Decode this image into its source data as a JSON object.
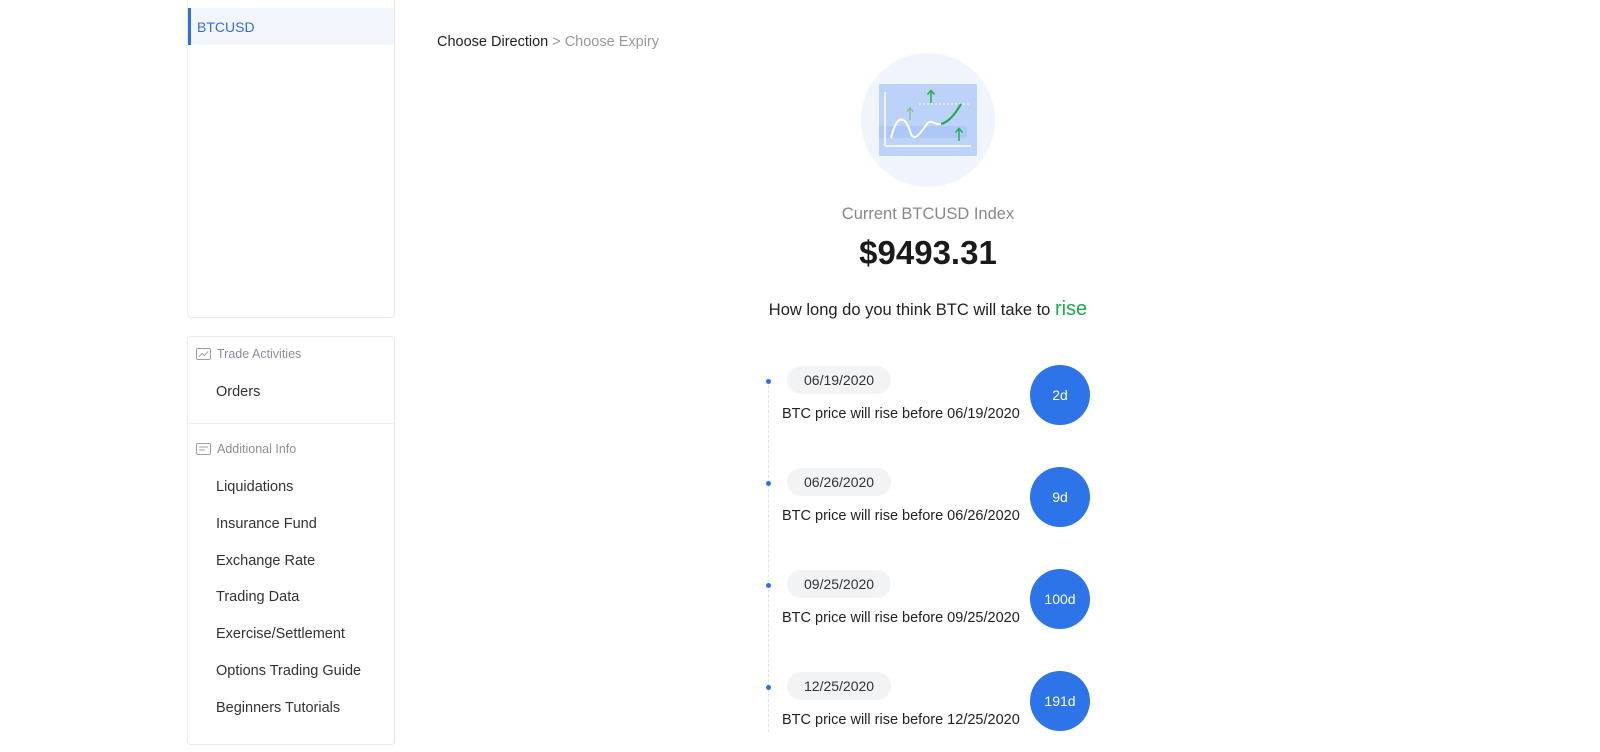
{
  "sidebar": {
    "instrument": "BTCUSD",
    "groups": [
      {
        "title": "Trade Activities",
        "icon": "chart-icon",
        "items": [
          "Orders"
        ]
      },
      {
        "title": "Additional Info",
        "icon": "document-icon",
        "items": [
          "Liquidations",
          "Insurance Fund",
          "Exchange Rate",
          "Trading Data",
          "Exercise/Settlement",
          "Options Trading Guide",
          "Beginners Tutorials"
        ]
      }
    ]
  },
  "breadcrumb": {
    "active": "Choose Direction",
    "separator": ">",
    "next": "Choose Expiry"
  },
  "hero": {
    "icon": "rising-chart-illustration",
    "index_label": "Current BTCUSD Index",
    "index_price": "$9493.31",
    "question_prefix": "How long do you think BTC will take to",
    "direction": "rise"
  },
  "expiries": [
    {
      "date": "06/19/2020",
      "description": "BTC price will rise before 06/19/2020",
      "days": "2d"
    },
    {
      "date": "06/26/2020",
      "description": "BTC price will rise before 06/26/2020",
      "days": "9d"
    },
    {
      "date": "09/25/2020",
      "description": "BTC price will rise before 09/25/2020",
      "days": "100d"
    },
    {
      "date": "12/25/2020",
      "description": "BTC price will rise before 12/25/2020",
      "days": "191d"
    }
  ],
  "colors": {
    "accent": "#2f6fe8",
    "rise": "#1aaa4c",
    "days_bubble": "#2c74e8"
  }
}
